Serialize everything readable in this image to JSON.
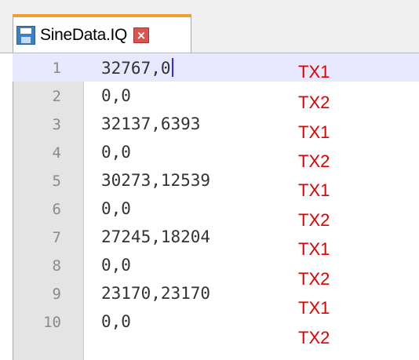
{
  "tab": {
    "title": "SineData.IQ",
    "save_icon": "save-icon",
    "close_icon": "close-icon"
  },
  "editor": {
    "lines": [
      {
        "num": "1",
        "text": "32767,0",
        "tag": "TX1"
      },
      {
        "num": "2",
        "text": "0,0",
        "tag": "TX2"
      },
      {
        "num": "3",
        "text": "32137,6393",
        "tag": "TX1"
      },
      {
        "num": "4",
        "text": "0,0",
        "tag": "TX2"
      },
      {
        "num": "5",
        "text": "30273,12539",
        "tag": "TX1"
      },
      {
        "num": "6",
        "text": "0,0",
        "tag": "TX2"
      },
      {
        "num": "7",
        "text": "27245,18204",
        "tag": "TX1"
      },
      {
        "num": "8",
        "text": "0,0",
        "tag": "TX2"
      },
      {
        "num": "9",
        "text": "23170,23170",
        "tag": "TX1"
      },
      {
        "num": "10",
        "text": "0,0",
        "tag": "TX2"
      }
    ]
  },
  "colors": {
    "annotation": "#e00000",
    "current_line": "#e8e8ff",
    "tab_accent": "#f0a030"
  }
}
